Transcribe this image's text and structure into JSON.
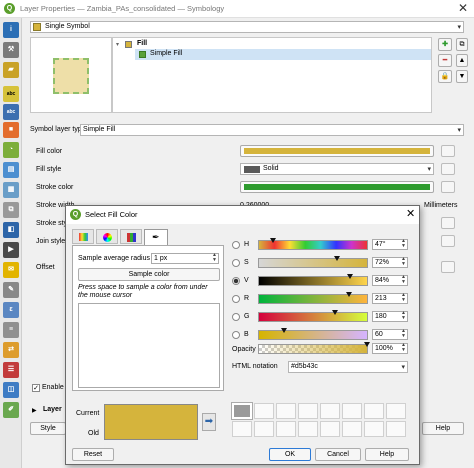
{
  "window": {
    "title": "Layer Properties — Zambia_PAs_consolidated — Symbology"
  },
  "renderer": {
    "selected": "Single Symbol"
  },
  "tree": {
    "root": "Fill",
    "child": "Simple Fill"
  },
  "symbol_layer_type": {
    "label": "Symbol layer type",
    "value": "Simple Fill"
  },
  "props": {
    "fill_color_label": "Fill color",
    "fill_style_label": "Fill style",
    "fill_style_value": "Solid",
    "stroke_color_label": "Stroke color",
    "stroke_width_label": "Stroke width",
    "stroke_width_value": "0.260000",
    "stroke_width_unit": "Millimeters",
    "stroke_style_label": "Stroke style",
    "join_style_label": "Join style",
    "offset_label": "Offset"
  },
  "enable_label": "Enable s",
  "layer_label": "Layer",
  "style_button": "Style",
  "help_button_main": "Help",
  "colors": {
    "fill": "#d5b43c",
    "stroke": "#2e9b2e",
    "style_swatch": "#5a5a5a"
  },
  "dialog": {
    "title": "Select Fill Color",
    "sample_radius_label": "Sample average radius",
    "sample_radius_value": "1 px",
    "sample_color_button": "Sample color",
    "hint": "Press space to sample a color from under the mouse cursor",
    "current_label": "Current",
    "old_label": "Old",
    "reset_button": "Reset",
    "ok_button": "OK",
    "cancel_button": "Cancel",
    "help_button": "Help",
    "opacity_label": "Opacity",
    "opacity_value": "100%",
    "html_label": "HTML notation",
    "html_value": "#d5b43c",
    "channels": [
      {
        "name": "H",
        "value": "47°",
        "level": 0.13
      },
      {
        "name": "S",
        "value": "72%",
        "level": 0.72
      },
      {
        "name": "V",
        "value": "84%",
        "level": 0.84
      },
      {
        "name": "R",
        "value": "213",
        "level": 0.835
      },
      {
        "name": "G",
        "value": "180",
        "level": 0.706
      },
      {
        "name": "B",
        "value": "60",
        "level": 0.235
      }
    ],
    "selected_channel": "V",
    "opacity_level": 1.0,
    "palette_first": "#9a9a9a"
  }
}
